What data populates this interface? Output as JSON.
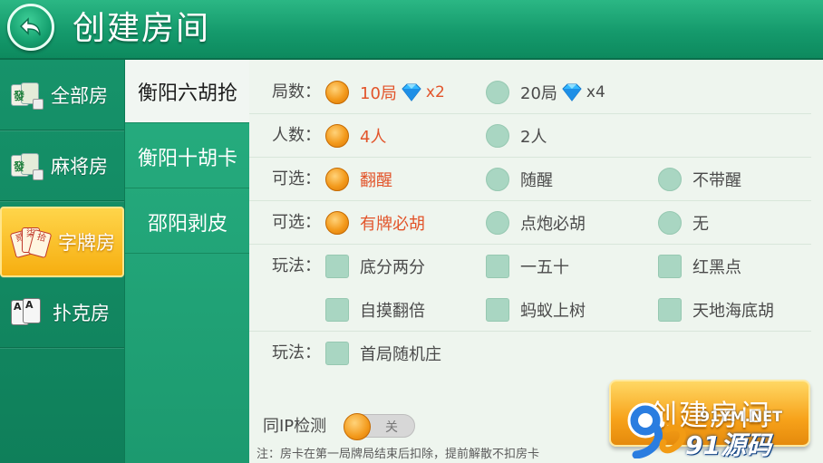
{
  "header": {
    "title": "创建房间",
    "back_icon": "back-arrow-icon"
  },
  "sidebar": {
    "items": [
      {
        "label": "全部房",
        "icon": "mahjong-tile-icon",
        "active": false
      },
      {
        "label": "麻将房",
        "icon": "mahjong-tile-icon",
        "active": false
      },
      {
        "label": "字牌房",
        "icon": "card-fan-icon",
        "active": true
      },
      {
        "label": "扑克房",
        "icon": "poker-cards-icon",
        "active": false
      }
    ],
    "card_icon_text": [
      "贰",
      "柒",
      "拾"
    ],
    "mahjong_glyph": "發",
    "poker_glyph": "A"
  },
  "games": {
    "items": [
      {
        "label": "衡阳六胡抢",
        "active": true
      },
      {
        "label": "衡阳十胡卡",
        "active": false
      },
      {
        "label": "邵阳剥皮",
        "active": false
      }
    ]
  },
  "options": {
    "rounds": {
      "label": "局数：",
      "choices": [
        {
          "text": "10局",
          "mult": "x2",
          "selected": true
        },
        {
          "text": "20局",
          "mult": "x4",
          "selected": false
        }
      ]
    },
    "players": {
      "label": "人数：",
      "choices": [
        {
          "text": "4人",
          "selected": true
        },
        {
          "text": "2人",
          "selected": false
        }
      ]
    },
    "optional1": {
      "label": "可选：",
      "choices": [
        {
          "text": "翻醒",
          "selected": true
        },
        {
          "text": "随醒",
          "selected": false
        },
        {
          "text": "不带醒",
          "selected": false
        }
      ]
    },
    "optional2": {
      "label": "可选：",
      "choices": [
        {
          "text": "有牌必胡",
          "selected": true
        },
        {
          "text": "点炮必胡",
          "selected": false
        },
        {
          "text": "无",
          "selected": false
        }
      ]
    },
    "play1": {
      "label": "玩法：",
      "checks": [
        {
          "text": "底分两分",
          "checked": false
        },
        {
          "text": "一五十",
          "checked": false
        },
        {
          "text": "红黑点",
          "checked": false
        },
        {
          "text": "自摸翻倍",
          "checked": false
        },
        {
          "text": "蚂蚁上树",
          "checked": false
        },
        {
          "text": "天地海底胡",
          "checked": false
        }
      ]
    },
    "play2": {
      "label": "玩法：",
      "checks": [
        {
          "text": "首局随机庄",
          "checked": false
        }
      ]
    }
  },
  "footer": {
    "ip_check_label": "同IP检测",
    "ip_toggle_text": "关",
    "ip_toggle_on": false,
    "note": "注：房卡在第一局牌局结束后扣除，提前解散不扣房卡",
    "create_button": "创建房间"
  },
  "watermark": {
    "top": "91YM.NET",
    "main": "91源码"
  },
  "colors": {
    "header_green": "#1aa574",
    "selected_text": "#e2542a",
    "accent_orange": "#f39a1c",
    "panel_bg": "#eef5ee"
  }
}
